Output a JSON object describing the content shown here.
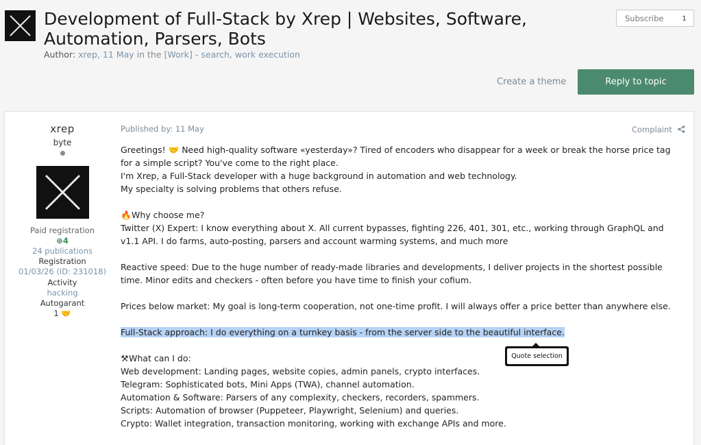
{
  "topic": {
    "title": "Development of Full-Stack by Xrep | Websites, Software, Automation, Parsers, Bots",
    "author_label": "Author:",
    "author": "xrep,",
    "date": "11 May",
    "in_text": "in the",
    "forum": "[Work] - search, work execution"
  },
  "subscribe": {
    "label": "Subscribe",
    "count": "1"
  },
  "actions": {
    "create_theme": "Create a theme",
    "reply": "Reply to topic"
  },
  "post": {
    "author": {
      "name": "xrep",
      "rank": "byte",
      "group": "Paid registration",
      "reputation": "4",
      "publications": "24 publications",
      "registration_label": "Registration",
      "registration_value": "01/03/26 (ID: 231018)",
      "activity_label": "Activity",
      "activity_value": "hacking",
      "autogarant_label": "Autogarant",
      "autogarant_value": "1"
    },
    "published": "Published by: 11 May",
    "complaint": "Complaint",
    "lines": {
      "l1": "Greetings! 🤝 Need high-quality software «yesterday»? Tired of encoders who disappear for a week or break the horse price tag for a simple script? You've come to the right place.",
      "l2": "I'm Xrep, a Full-Stack developer with a huge background in automation and web technology.",
      "l3": "My specialty is solving problems that others refuse.",
      "why_icon": "🔥",
      "why": "Why choose me?",
      "twitter": "Twitter (X) Expert: I know everything about X. All current bypasses, fighting 226, 401, 301, etc., working through GraphQL and v1.1 API. I do farms, auto-posting, parsers and account warming systems, and much more",
      "speed": "Reactive speed: Due to the huge number of ready-made libraries and developments, I deliver projects in the shortest possible time. Minor edits and checkers - often before you have time to finish your cofium.",
      "prices": "Prices below market: My goal is long-term cooperation, not one-time profit. I will always offer a price better than anywhere else.",
      "fullstack": "Full-Stack approach: I do everything on a turnkey basis - from the server side to the beautiful interface.",
      "cando_icon": "⚒",
      "cando": "What can I do:",
      "web": "Web development: Landing pages, website copies, admin panels, crypto interfaces.",
      "telegram": "Telegram: Sophisticated bots, Mini Apps (TWA), channel automation.",
      "automation": "Automation & Software: Parsers of any complexity, checkers, recorders, spammers.",
      "scripts": "Scripts: Automation of browser (Puppeteer, Playwright, Selenium) and queries.",
      "crypto": "Crypto: Wallet integration, transaction monitoring, working with exchange APIs and more."
    }
  },
  "tooltip": {
    "label": "Quote selection"
  }
}
